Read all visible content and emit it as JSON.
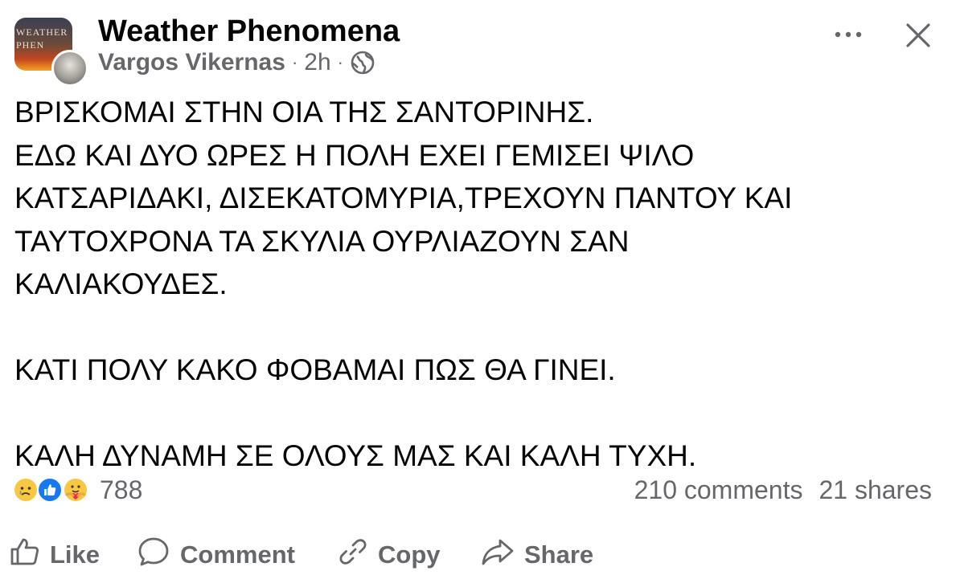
{
  "header": {
    "group_name": "Weather Phenomena",
    "author": "Vargos Vikernas",
    "separator": "·",
    "time": "2h",
    "privacy_icon": "globe-icon",
    "group_avatar_text": "WEATHER\nPHEN",
    "more_icon": "more-horizontal-icon",
    "close_icon": "close-icon"
  },
  "post": {
    "text": "ΒΡΙΣΚΟΜΑΙ ΣΤΗΝ ΟΙΑ ΤΗΣ ΣΑΝΤΟΡΙΝΗΣ.\nΕΔΩ ΚΑΙ ΔΥΟ ΩΡΕΣ Η ΠΟΛΗ ΕΧΕΙ ΓΕΜΙΣΕΙ ΨΙΛΟ\nΚΑΤΣΑΡΙΔΑΚΙ, ΔΙΣΕΚΑΤΟΜΥΡΙΑ,ΤΡΕΧΟΥΝ ΠΑΝΤΟΥ ΚΑΙ\nΤΑΥΤΟΧΡΟΝΑ ΤΑ ΣΚΥΛΙΑ ΟΥΡΛΙΑΖΟΥΝ ΣΑΝ\nΚΑΛΙΑΚΟΥΔΕΣ.\n\nΚΑΤΙ ΠΟΛΥ ΚΑΚΟ ΦΟΒΑΜΑΙ ΠΩΣ ΘΑ ΓΙΝΕΙ.\n\nΚΑΛΗ ΔΥΝΑΜΗ ΣΕ ΟΛΟΥΣ ΜΑΣ ΚΑΙ ΚΑΛΗ ΤΥΧΗ."
  },
  "reactions": {
    "types": [
      "sad",
      "like",
      "care"
    ],
    "count": "788"
  },
  "stats": {
    "comments": "210 comments",
    "shares": "21 shares"
  },
  "actions": {
    "like": "Like",
    "comment": "Comment",
    "copy": "Copy",
    "share": "Share"
  },
  "colors": {
    "text": "#050505",
    "secondary_text": "#65676b",
    "like_blue": "#1877f2",
    "reaction_yellow": "#f7c844"
  }
}
